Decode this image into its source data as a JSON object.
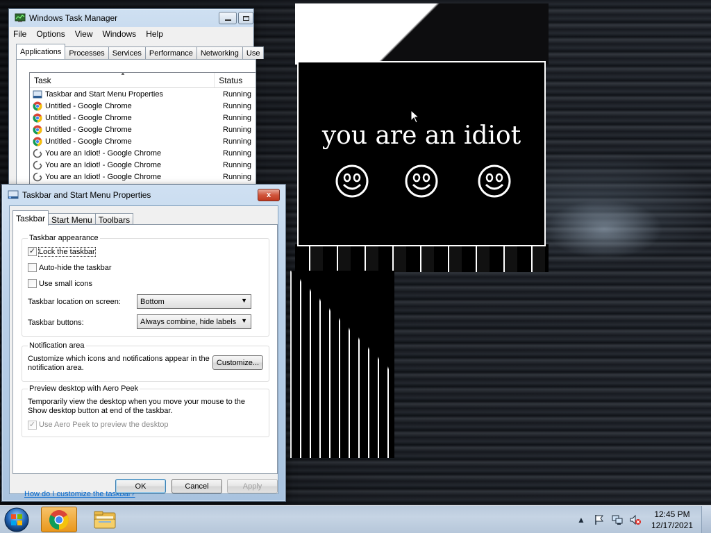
{
  "task_manager": {
    "title": "Windows Task Manager",
    "menu": [
      "File",
      "Options",
      "View",
      "Windows",
      "Help"
    ],
    "tabs": [
      "Applications",
      "Processes",
      "Services",
      "Performance",
      "Networking",
      "Use"
    ],
    "columns": {
      "task": "Task",
      "status": "Status"
    },
    "rows": [
      {
        "task": "Taskbar and Start Menu Properties",
        "status": "Running",
        "icon": "taskbar-icon"
      },
      {
        "task": "Untitled - Google Chrome",
        "status": "Running",
        "icon": "chrome-icon"
      },
      {
        "task": "Untitled - Google Chrome",
        "status": "Running",
        "icon": "chrome-icon"
      },
      {
        "task": "Untitled - Google Chrome",
        "status": "Running",
        "icon": "chrome-icon"
      },
      {
        "task": "Untitled - Google Chrome",
        "status": "Running",
        "icon": "chrome-icon"
      },
      {
        "task": "You are an Idiot! - Google Chrome",
        "status": "Running",
        "icon": "loading-icon"
      },
      {
        "task": "You are an Idiot! - Google Chrome",
        "status": "Running",
        "icon": "loading-icon"
      },
      {
        "task": "You are an Idiot! - Google Chrome",
        "status": "Running",
        "icon": "loading-icon"
      }
    ]
  },
  "props": {
    "title": "Taskbar and Start Menu Properties",
    "close_glyph": "x",
    "tabs": [
      "Taskbar",
      "Start Menu",
      "Toolbars"
    ],
    "appearance": {
      "title": "Taskbar appearance",
      "lock": {
        "label": "Lock the taskbar",
        "checked": true
      },
      "autohide": {
        "label": "Auto-hide the taskbar",
        "checked": false
      },
      "small": {
        "label": "Use small icons",
        "checked": false
      },
      "location_label": "Taskbar location on screen:",
      "location_value": "Bottom",
      "buttons_label": "Taskbar buttons:",
      "buttons_value": "Always combine, hide labels"
    },
    "notification": {
      "title": "Notification area",
      "desc_line1": "Customize which icons and notifications appear in the",
      "desc_line2": "notification area.",
      "customize_label": "Customize..."
    },
    "peek": {
      "title": "Preview desktop with Aero Peek",
      "desc_line1": "Temporarily view the desktop when you move your mouse to the",
      "desc_line2": "Show desktop button at end of the taskbar.",
      "checkbox_label": "Use Aero Peek to preview the desktop",
      "checked": true
    },
    "help_link": "How do I customize the taskbar?",
    "ok_label": "OK",
    "cancel_label": "Cancel",
    "apply_label": "Apply"
  },
  "popup": {
    "text": "you are an idiot",
    "smileys": 3
  },
  "taskbar": {
    "time": "12:45 PM",
    "date": "12/17/2021",
    "tray_icons": [
      "show-hidden-icon",
      "action-center-flag-icon",
      "network-icon",
      "volume-muted-icon"
    ]
  },
  "colors": {
    "link": "#0066cc",
    "taskbar": "#c6d4e4",
    "popup_bg": "#000000",
    "popup_fg": "#ffffff"
  }
}
